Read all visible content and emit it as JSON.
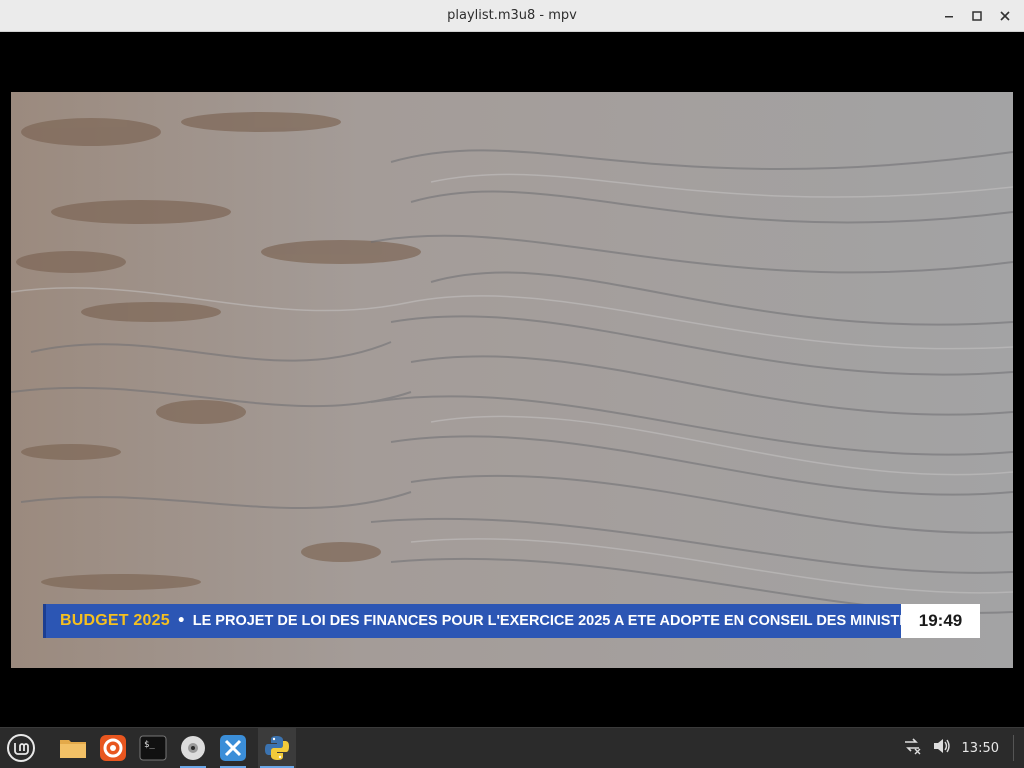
{
  "window": {
    "title": "playlist.m3u8 - mpv"
  },
  "ticker": {
    "topic": "BUDGET 2025",
    "separator": "•",
    "headline": "LE PROJET DE LOI DES FINANCES POUR L'EXERCICE 2025 A ETE ADOPTE EN CONSEIL DES MINISTRES, CE JEUDI",
    "clock": "19:49"
  },
  "taskbar": {
    "launchers": [
      {
        "name": "files",
        "icon": "folder-icon"
      },
      {
        "name": "firefox",
        "icon": "firefox-icon"
      },
      {
        "name": "terminal",
        "icon": "terminal-icon"
      },
      {
        "name": "disc",
        "icon": "disc-icon"
      },
      {
        "name": "software",
        "icon": "software-manager-icon"
      },
      {
        "name": "python",
        "icon": "python-icon"
      }
    ],
    "tray": {
      "clock": "13:50"
    }
  }
}
